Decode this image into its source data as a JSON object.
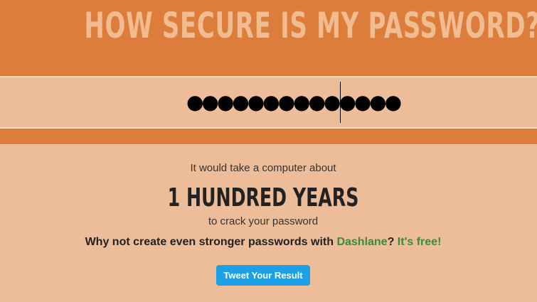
{
  "header": {
    "title": "HOW SECURE IS MY PASSWORD?"
  },
  "password": {
    "masked_value": "●●●●●●●●●●●●●●",
    "length": 14
  },
  "result": {
    "intro": "It would take a computer about",
    "time": "1 HUNDRED YEARS",
    "outro": "to crack your password",
    "promo_prefix": "Why not create even stronger passwords with ",
    "promo_link": "Dashlane",
    "promo_mid": "? ",
    "promo_free": "It's free!"
  },
  "actions": {
    "tweet_label": "Tweet Your Result"
  },
  "colors": {
    "header_bg": "#dc7d3b",
    "page_bg": "#ecbd98",
    "title_text": "#f0bc90",
    "link_green": "#3b8a3e",
    "tweet_blue": "#1da1e6"
  }
}
